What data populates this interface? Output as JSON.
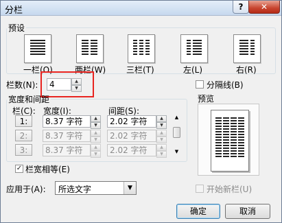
{
  "window": {
    "title": "分栏",
    "help_label": "?",
    "close_label": "✕"
  },
  "presets": {
    "legend": "预设",
    "items": [
      {
        "label": "一栏(O)"
      },
      {
        "label": "两栏(W)"
      },
      {
        "label": "三栏(T)"
      },
      {
        "label": "左(L)"
      },
      {
        "label": "右(R)"
      }
    ]
  },
  "columns_count": {
    "label": "栏数(N):",
    "value": "4"
  },
  "separator": {
    "label": "分隔线(B)",
    "checked": false
  },
  "width_spacing": {
    "legend": "宽度和间距",
    "col_header": "栏(C):",
    "width_header": "宽度(I):",
    "spacing_header": "间距(S):",
    "rows": [
      {
        "col": "1:",
        "width": "8.37 字符",
        "spacing": "2.02 字符",
        "enabled": true
      },
      {
        "col": "2:",
        "width": "8.37 字符",
        "spacing": "2.02 字符",
        "enabled": false
      },
      {
        "col": "3:",
        "width": "8.37 字符",
        "spacing": "2.02 字符",
        "enabled": false
      }
    ]
  },
  "preview": {
    "label": "预览"
  },
  "equal_width": {
    "label": "栏宽相等(E)",
    "checked": true
  },
  "apply_to": {
    "label": "应用于(A):",
    "value": "所选文字"
  },
  "new_column": {
    "label": "开始新栏(U)",
    "checked": false,
    "enabled": false
  },
  "buttons": {
    "ok": "确定",
    "cancel": "取消"
  },
  "icons": {
    "spin_up": "▲",
    "spin_down": "▼",
    "dropdown": "▼",
    "scroll_up": "▲",
    "scroll_down": "▼",
    "check": "✓"
  }
}
